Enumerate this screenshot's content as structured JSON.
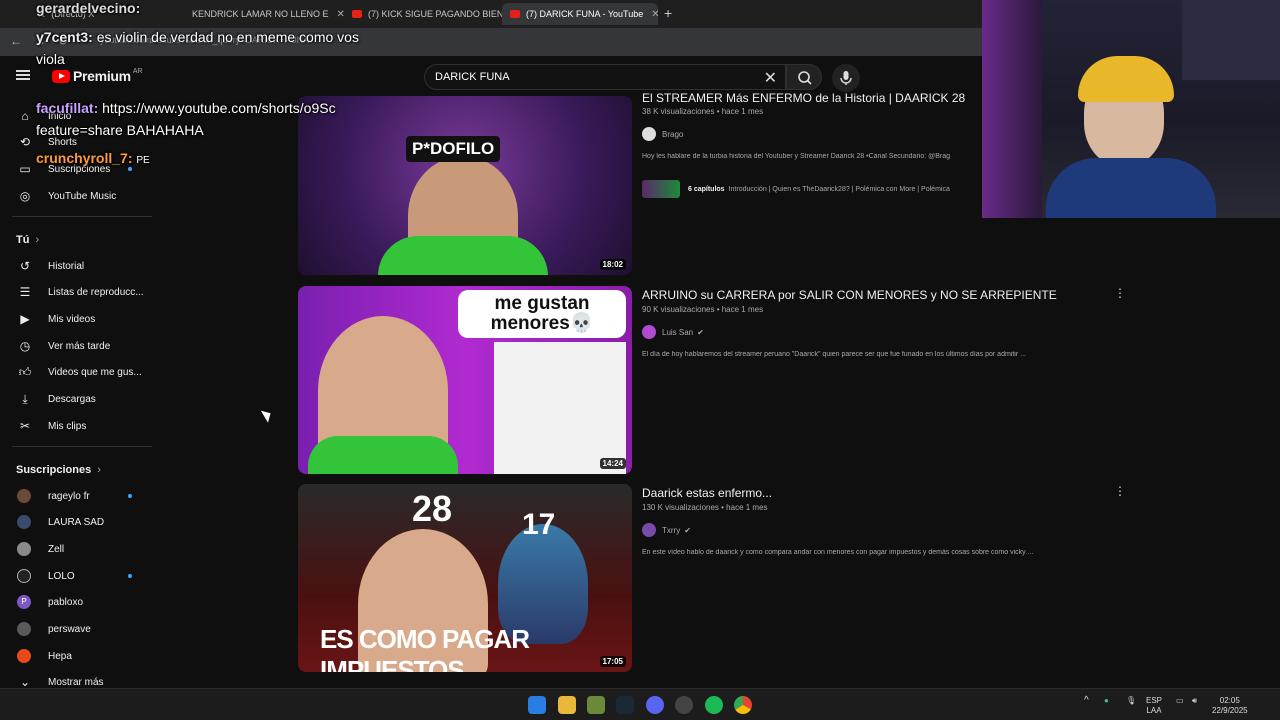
{
  "browser": {
    "tabs": [
      {
        "label": "(Directo) X"
      },
      {
        "label": "KENDRICK LAMAR NO LLENO E"
      },
      {
        "label": "(7) KICK SIGUE PAGANDO BIEN"
      },
      {
        "label": "(7) DARICK FUNA - YouTube"
      }
    ],
    "url": "youtube.com/results?search_query=DARICK+FUNA"
  },
  "youtube": {
    "logo_word": "Premium",
    "country": "AR",
    "search_query": "DARICK FUNA"
  },
  "sidebar": {
    "main": [
      {
        "label": "Inicio",
        "icon": "home-icon"
      },
      {
        "label": "Shorts",
        "icon": "shorts-icon"
      },
      {
        "label": "Suscripciones",
        "icon": "subscriptions-icon"
      },
      {
        "label": "YouTube Music",
        "icon": "music-icon"
      }
    ],
    "you_heading": "Tú",
    "you": [
      {
        "label": "Historial",
        "icon": "history-icon"
      },
      {
        "label": "Listas de reproducc...",
        "icon": "playlists-icon"
      },
      {
        "label": "Mis videos",
        "icon": "my-videos-icon"
      },
      {
        "label": "Ver más tarde",
        "icon": "watch-later-icon"
      },
      {
        "label": "Videos que me gus...",
        "icon": "liked-icon"
      },
      {
        "label": "Descargas",
        "icon": "download-icon"
      },
      {
        "label": "Mis clips",
        "icon": "clips-icon"
      }
    ],
    "subs_heading": "Suscripciones",
    "subs": [
      {
        "label": "rageylo fr",
        "color": "#6a4a3a"
      },
      {
        "label": "LAURA SAD",
        "color": "#3a4a6a"
      },
      {
        "label": "Zell",
        "color": "#8a8a8a"
      },
      {
        "label": "LOLO",
        "color": "#222222"
      },
      {
        "label": "pabloxo",
        "color": "#7e57c2"
      },
      {
        "label": "perswave",
        "color": "#5a5a5a"
      },
      {
        "label": "Hepa",
        "color": "#e64a19"
      }
    ],
    "show_more": "Mostrar más"
  },
  "results": [
    {
      "title": "El STREAMER Más ENFERMO de la Historia | DAARICK 28",
      "meta": "38 K visualizaciones • hace 1 mes",
      "channel": "Brago",
      "verified": false,
      "description": "Hoy les hablare de la turbia historia del Youtuber y Streamer Daarick 28 •Canal Secundario: @Brag",
      "duration": "18:02",
      "thumb_text": "P*DOFILO",
      "chapters_label": "6 capítulos",
      "chapters_text": "Introducción | Quien es TheDaarick28? | Polémica con More | Polémica"
    },
    {
      "title": "ARRUINO su CARRERA por SALIR CON MENORES y NO SE ARREPIENTE",
      "meta": "90 K visualizaciones • hace 1 mes",
      "channel": "Luis San",
      "verified": true,
      "description": "El día de hoy hablaremos del streamer peruano \"Daarick\" quien parece ser que fue funado en los últimos días por admitir ...",
      "duration": "14:24",
      "thumb_text": "me gustan menores💀"
    },
    {
      "title": "Daarick estas enfermo...",
      "meta": "130 K visualizaciones • hace 1 mes",
      "channel": "Txrry",
      "verified": true,
      "description": "En este vídeo hablo de daarick y como compara andar con menores con pagar impuestos y demás cosas sobre como vicky ...",
      "duration": "17:05",
      "thumb_num_a": "28",
      "thumb_num_b": "17",
      "thumb_text": "ES COMO PAGAR IMPUESTOS"
    }
  ],
  "chat": [
    {
      "user": "gerardelvecino:",
      "text": ""
    },
    {
      "user": "y7cent3:",
      "text": "es violin de verdad no en meme como vos viola"
    },
    {
      "user": "facufillat:",
      "text": "https://www.youtube.com/shorts/o9Sc feature=share BAHAHAHA"
    },
    {
      "user": "crunchyroll_7:",
      "text": "PE"
    }
  ],
  "taskbar": {
    "lang_top": "ESP",
    "lang_bottom": "LAA",
    "time": "02:05",
    "date": "22/9/2025"
  }
}
